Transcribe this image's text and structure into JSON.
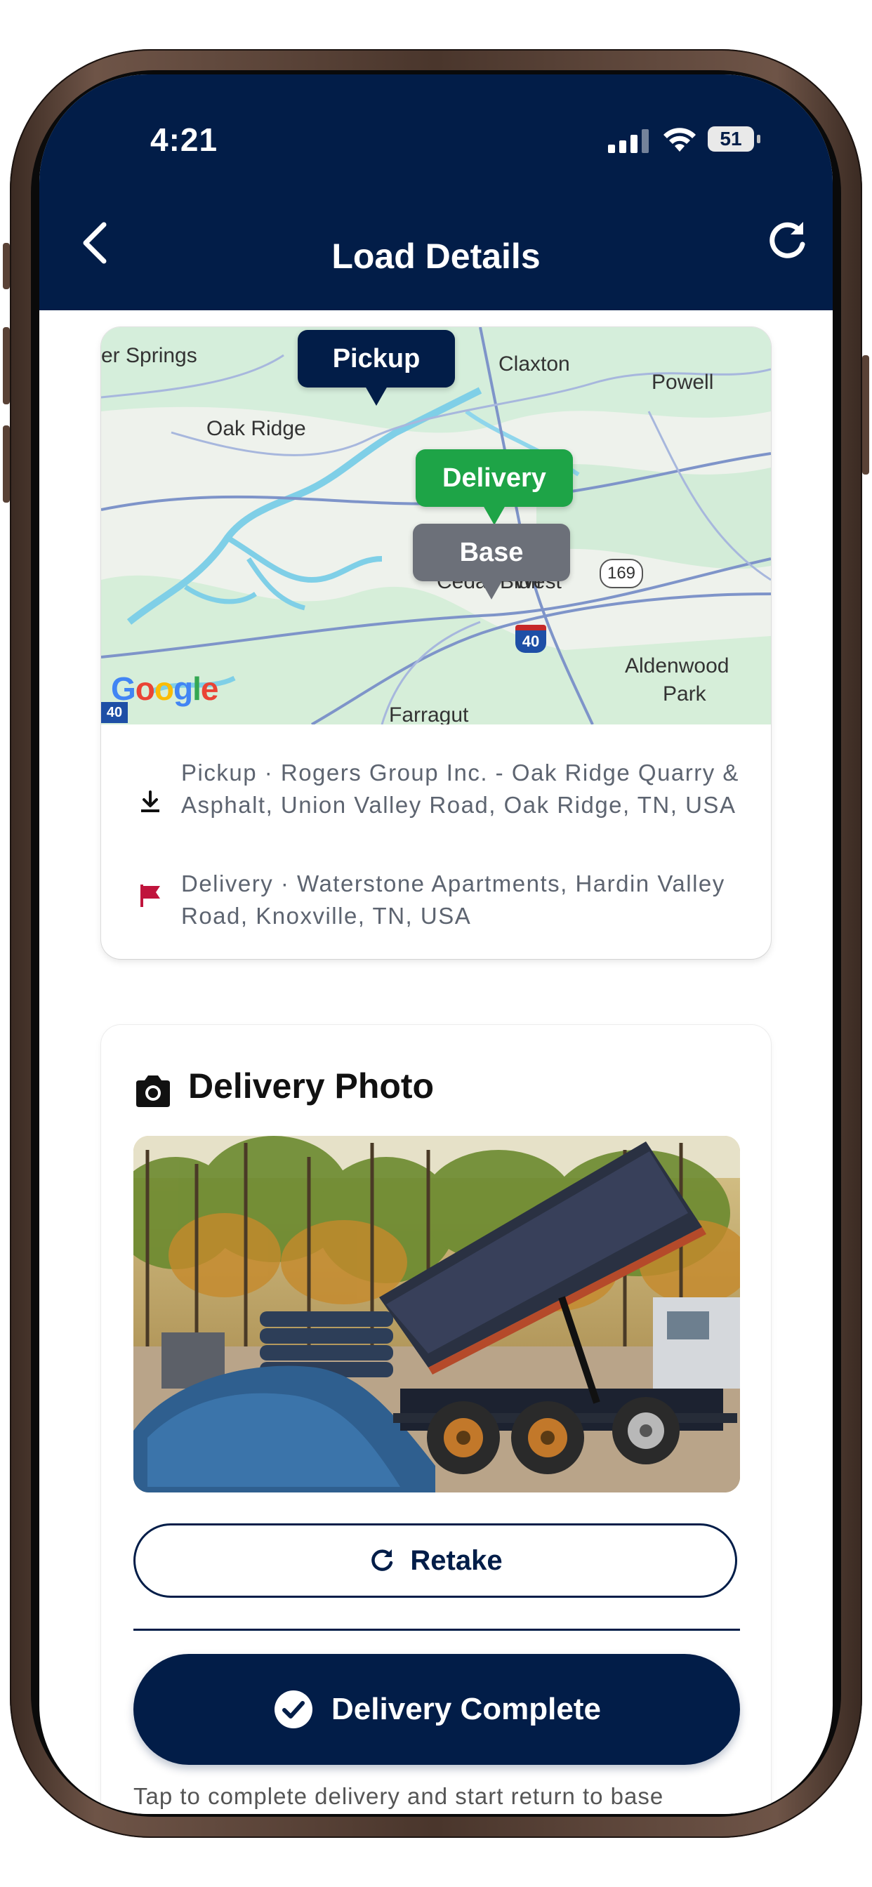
{
  "status_bar": {
    "time": "4:21",
    "battery": "51"
  },
  "header": {
    "title": "Load Details",
    "back_icon": "chevron-left-icon",
    "refresh_icon": "refresh-icon"
  },
  "map": {
    "labels": {
      "springs": "er Springs",
      "claxton": "Claxton",
      "powell": "Powell",
      "oak_ridge": "Oak Ridge",
      "cedar_bluff": "Cedar Bluff",
      "west": "West",
      "route_169": "169",
      "i40_shield": "40",
      "i40_corner": "40",
      "aldenwood_1": "Aldenwood",
      "aldenwood_2": "Park",
      "farragut": "Farragut"
    },
    "markers": {
      "pickup": "Pickup",
      "delivery": "Delivery",
      "base": "Base"
    },
    "attribution": "Google",
    "colors": {
      "pickup": "#021d48",
      "delivery": "#1ea447",
      "base": "#6c7079"
    }
  },
  "stops": [
    {
      "icon": "download-icon",
      "text": "Pickup · Rogers Group Inc. - Oak Ridge Quarry & Asphalt, Union Valley Road, Oak Ridge, TN, USA"
    },
    {
      "icon": "flag-icon",
      "text": "Delivery · Waterstone Apartments, Hardin Valley Road, Knoxville, TN, USA"
    }
  ],
  "photo_section": {
    "title": "Delivery Photo",
    "icon": "camera-icon",
    "image_subject": "dump truck unloading gravel",
    "retake_label": "Retake",
    "complete_label": "Delivery Complete",
    "hint": "Tap to complete delivery and start return to base"
  },
  "colors": {
    "primary": "#021d48",
    "accent_green": "#1ea447",
    "flag_red": "#c0143c"
  }
}
